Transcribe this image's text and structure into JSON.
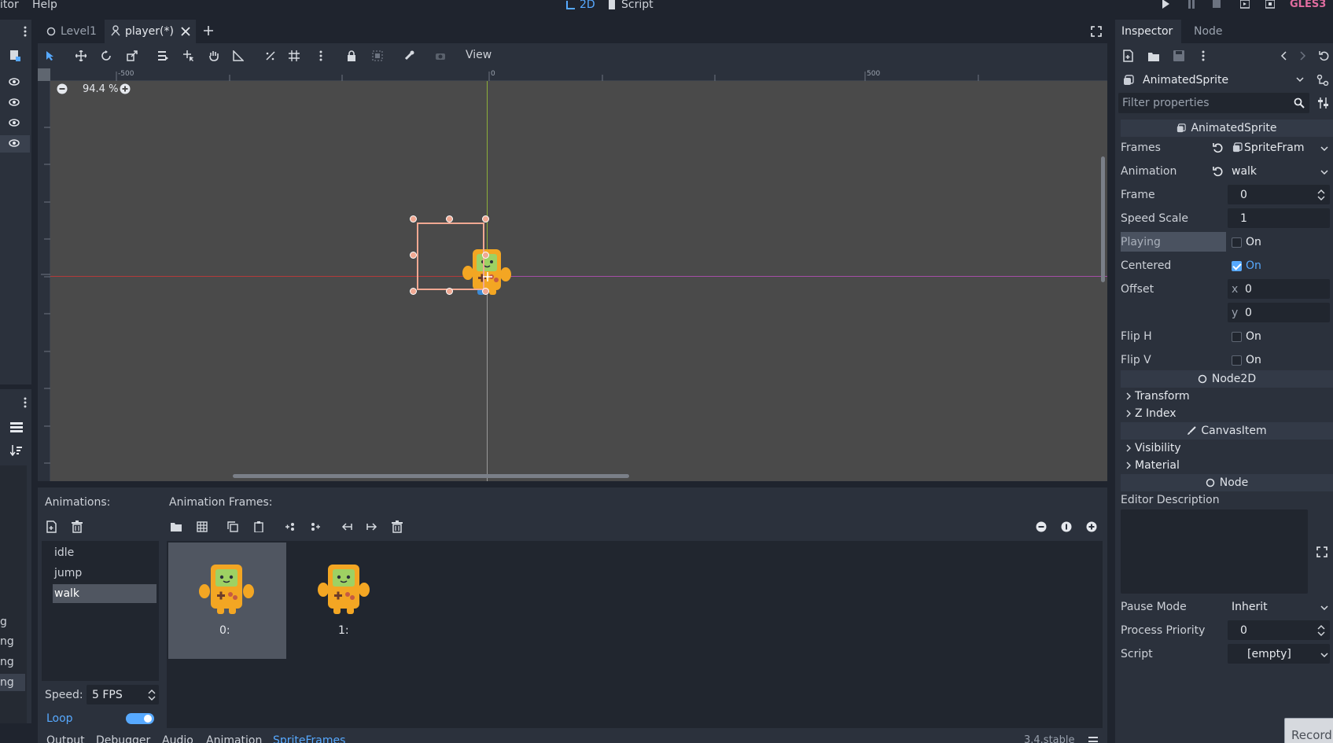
{
  "menu": {
    "editor": "itor",
    "help": "Help"
  },
  "top_center": {
    "mode_2d": "2D",
    "mode_script": "Script"
  },
  "renderer": "GLES3",
  "scene_tabs": [
    {
      "label": "Level1"
    },
    {
      "label": "player(*)"
    }
  ],
  "toolbar": {
    "view_label": "View"
  },
  "viewport": {
    "zoom": "94.4 %",
    "ruler_labels": [
      "-500",
      "0",
      "500"
    ]
  },
  "animations_panel": {
    "title": "Animations:",
    "items": [
      "idle",
      "jump",
      "walk"
    ],
    "selected": "walk",
    "speed_label": "Speed:",
    "speed_value": "5 FPS",
    "loop_label": "Loop",
    "loop_on": true
  },
  "frames_panel": {
    "title": "Animation Frames:",
    "frames": [
      {
        "label": "0:"
      },
      {
        "label": "1:"
      }
    ],
    "selected_index": 0
  },
  "bottom_tabs": [
    "Output",
    "Debugger",
    "Audio",
    "Animation",
    "SpriteFrames"
  ],
  "bottom_active": "SpriteFrames",
  "version": "3.4.stable",
  "left_dock": {
    "partial_items": [
      "g",
      "ng",
      "ng",
      "ng"
    ]
  },
  "inspector": {
    "tab_inspector": "Inspector",
    "tab_node": "Node",
    "node_name": "AnimatedSprite",
    "filter_placeholder": "Filter properties",
    "section_animated_sprite": "AnimatedSprite",
    "props": {
      "frames": {
        "label": "Frames",
        "value": "SpriteFram"
      },
      "animation": {
        "label": "Animation",
        "value": "walk"
      },
      "frame": {
        "label": "Frame",
        "value": "0"
      },
      "speed_scale": {
        "label": "Speed Scale",
        "value": "1"
      },
      "playing": {
        "label": "Playing",
        "value": "On",
        "checked": false
      },
      "centered": {
        "label": "Centered",
        "value": "On",
        "checked": true
      },
      "offset": {
        "label": "Offset",
        "x_label": "x",
        "x": "0",
        "y_label": "y",
        "y": "0"
      },
      "flip_h": {
        "label": "Flip H",
        "value": "On",
        "checked": false
      },
      "flip_v": {
        "label": "Flip V",
        "value": "On",
        "checked": false
      }
    },
    "section_node2d": "Node2D",
    "node2d_groups": [
      "Transform",
      "Z Index"
    ],
    "section_canvas_item": "CanvasItem",
    "canvas_groups": [
      "Visibility",
      "Material"
    ],
    "section_node": "Node",
    "editor_description": "Editor Description",
    "pause_mode": {
      "label": "Pause Mode",
      "value": "Inherit"
    },
    "process_priority": {
      "label": "Process Priority",
      "value": "0"
    },
    "script": {
      "label": "Script",
      "value": "[empty]"
    }
  },
  "record_button": "Record",
  "colors": {
    "accent": "#57a9ff",
    "renderer": "#e06c9f",
    "selection_box": "#f0a892"
  }
}
